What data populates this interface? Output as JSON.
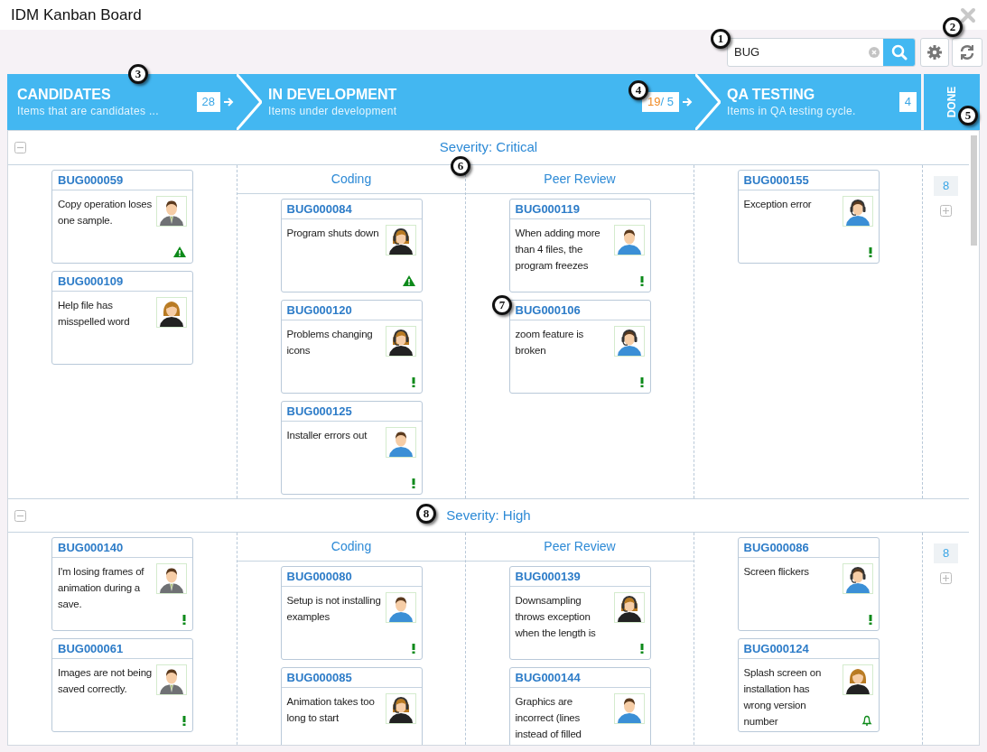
{
  "window": {
    "title": "IDM Kanban Board"
  },
  "toolbar": {
    "search": {
      "value": "BUG"
    }
  },
  "stages": [
    {
      "title": "CANDIDATES",
      "subtitle": "Items that are candidates ...",
      "count": "28",
      "over_limit": false
    },
    {
      "title": "IN DEVELOPMENT",
      "subtitle": "Items under development",
      "count": "19/ 5",
      "over_limit": true
    },
    {
      "title": "QA TESTING",
      "subtitle": "Items in QA testing cycle.",
      "count": "4",
      "over_limit": false
    },
    {
      "title": "DONE"
    }
  ],
  "lanes": [
    {
      "title": "Severity: Critical",
      "expanded": true,
      "candidates": [
        {
          "id": "BUG000059",
          "text": "Copy operation loses one sample.",
          "avatar": {
            "kind": "man-suit"
          },
          "flag": {
            "kind": "warning"
          }
        },
        {
          "id": "BUG000109",
          "text": "Help file has misspelled word",
          "avatar": {
            "kind": "woman"
          }
        }
      ],
      "development": [
        {
          "heading": "Coding",
          "cards": [
            {
              "id": "BUG000084",
              "text": "Program shuts down",
              "avatar": {
                "kind": "woman-headset"
              },
              "flag": {
                "kind": "warning"
              }
            },
            {
              "id": "BUG000120",
              "text": "Problems changing icons",
              "avatar": {
                "kind": "woman-headset"
              },
              "flag": {
                "kind": "exclamation"
              }
            },
            {
              "id": "BUG000125",
              "text": "Installer errors out",
              "avatar": {
                "kind": "man"
              },
              "flag": {
                "kind": "exclamation"
              }
            }
          ]
        },
        {
          "heading": "Peer Review",
          "cards": [
            {
              "id": "BUG000119",
              "text": "When adding more than 4 files, the program freezes",
              "avatar": {
                "kind": "man"
              },
              "flag": {
                "kind": "exclamation"
              }
            },
            {
              "id": "BUG000106",
              "text": "zoom feature is broken",
              "avatar": {
                "kind": "man-headset"
              },
              "flag": {
                "kind": "exclamation"
              }
            }
          ]
        }
      ],
      "qa": [
        {
          "id": "BUG000155",
          "text": "Exception error",
          "avatar": {
            "kind": "man-headset"
          },
          "flag": {
            "kind": "exclamation"
          }
        }
      ],
      "done_count": "8"
    },
    {
      "title": "Severity: High",
      "expanded": true,
      "candidates": [
        {
          "id": "BUG000140",
          "text": "I'm losing frames of animation during a save.",
          "avatar": {
            "kind": "man-suit"
          },
          "flag": {
            "kind": "exclamation"
          }
        },
        {
          "id": "BUG000061",
          "text": "Images are not being saved correctly.",
          "avatar": {
            "kind": "man-suit"
          },
          "flag": {
            "kind": "exclamation"
          }
        }
      ],
      "development": [
        {
          "heading": "Coding",
          "cards": [
            {
              "id": "BUG000080",
              "text": "Setup is not installing examples",
              "avatar": {
                "kind": "man"
              },
              "flag": {
                "kind": "exclamation"
              }
            },
            {
              "id": "BUG000085",
              "text": "Animation takes too long to start",
              "avatar": {
                "kind": "woman-headset"
              }
            }
          ]
        },
        {
          "heading": "Peer Review",
          "cards": [
            {
              "id": "BUG000139",
              "text": "Downsampling throws exception when the length is",
              "avatar": {
                "kind": "woman-headset"
              },
              "flag": {
                "kind": "exclamation"
              }
            },
            {
              "id": "BUG000144",
              "text": "Graphics are incorrect (lines instead of filled",
              "avatar": {
                "kind": "man"
              }
            }
          ]
        }
      ],
      "qa": [
        {
          "id": "BUG000086",
          "text": "Screen flickers",
          "avatar": {
            "kind": "man-headset"
          },
          "flag": {
            "kind": "exclamation"
          }
        },
        {
          "id": "BUG000124",
          "text": "Splash screen on installation has wrong version number",
          "avatar": {
            "kind": "woman"
          },
          "flag": {
            "kind": "bell"
          }
        }
      ],
      "done_count": "8"
    }
  ],
  "callouts": [
    {
      "number": "1"
    },
    {
      "number": "2"
    },
    {
      "number": "3"
    },
    {
      "number": "4"
    },
    {
      "number": "5"
    },
    {
      "number": "6"
    },
    {
      "number": "7"
    },
    {
      "number": "8"
    }
  ]
}
